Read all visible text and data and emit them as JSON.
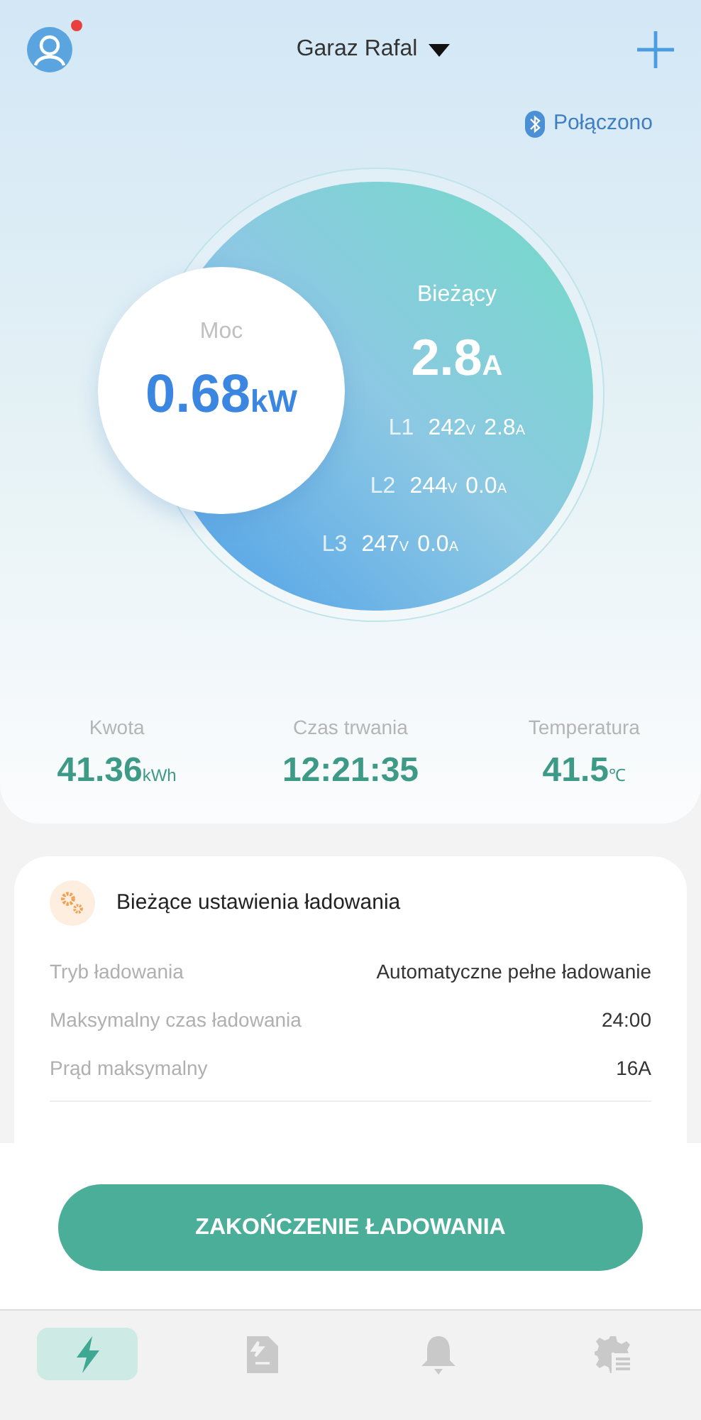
{
  "header": {
    "title": "Garaz Rafal",
    "notification": true
  },
  "connection": {
    "label": "Połączono"
  },
  "gauge": {
    "power": {
      "label": "Moc",
      "value": "0.68",
      "unit": "kW"
    },
    "current": {
      "label": "Bieżący",
      "value": "2.8",
      "unit": "A"
    },
    "phases": [
      {
        "label": "L1",
        "voltage": "242",
        "voltage_unit": "V",
        "current": "2.8",
        "current_unit": "A"
      },
      {
        "label": "L2",
        "voltage": "244",
        "voltage_unit": "V",
        "current": "0.0",
        "current_unit": "A"
      },
      {
        "label": "L3",
        "voltage": "247",
        "voltage_unit": "V",
        "current": "0.0",
        "current_unit": "A"
      }
    ]
  },
  "stats": [
    {
      "label": "Kwota",
      "value": "41.36",
      "unit": "kWh"
    },
    {
      "label": "Czas trwania",
      "value": "12:21:35"
    },
    {
      "label": "Temperatura",
      "value": "41.5",
      "unit": "℃"
    }
  ],
  "settings": {
    "title": "Bieżące ustawienia ładowania",
    "rows": [
      {
        "label": "Tryb ładowania",
        "value": "Automatyczne pełne ładowanie"
      },
      {
        "label": "Maksymalny czas ładowania",
        "value": "24:00"
      },
      {
        "label": "Prąd maksymalny",
        "value": "16A"
      }
    ]
  },
  "action_button": "ZAKOŃCZENIE ŁADOWANIA",
  "nav": [
    {
      "kind": "charging",
      "selected": true
    },
    {
      "kind": "records",
      "selected": false
    },
    {
      "kind": "alerts",
      "selected": false
    },
    {
      "kind": "settings",
      "selected": false
    }
  ]
}
